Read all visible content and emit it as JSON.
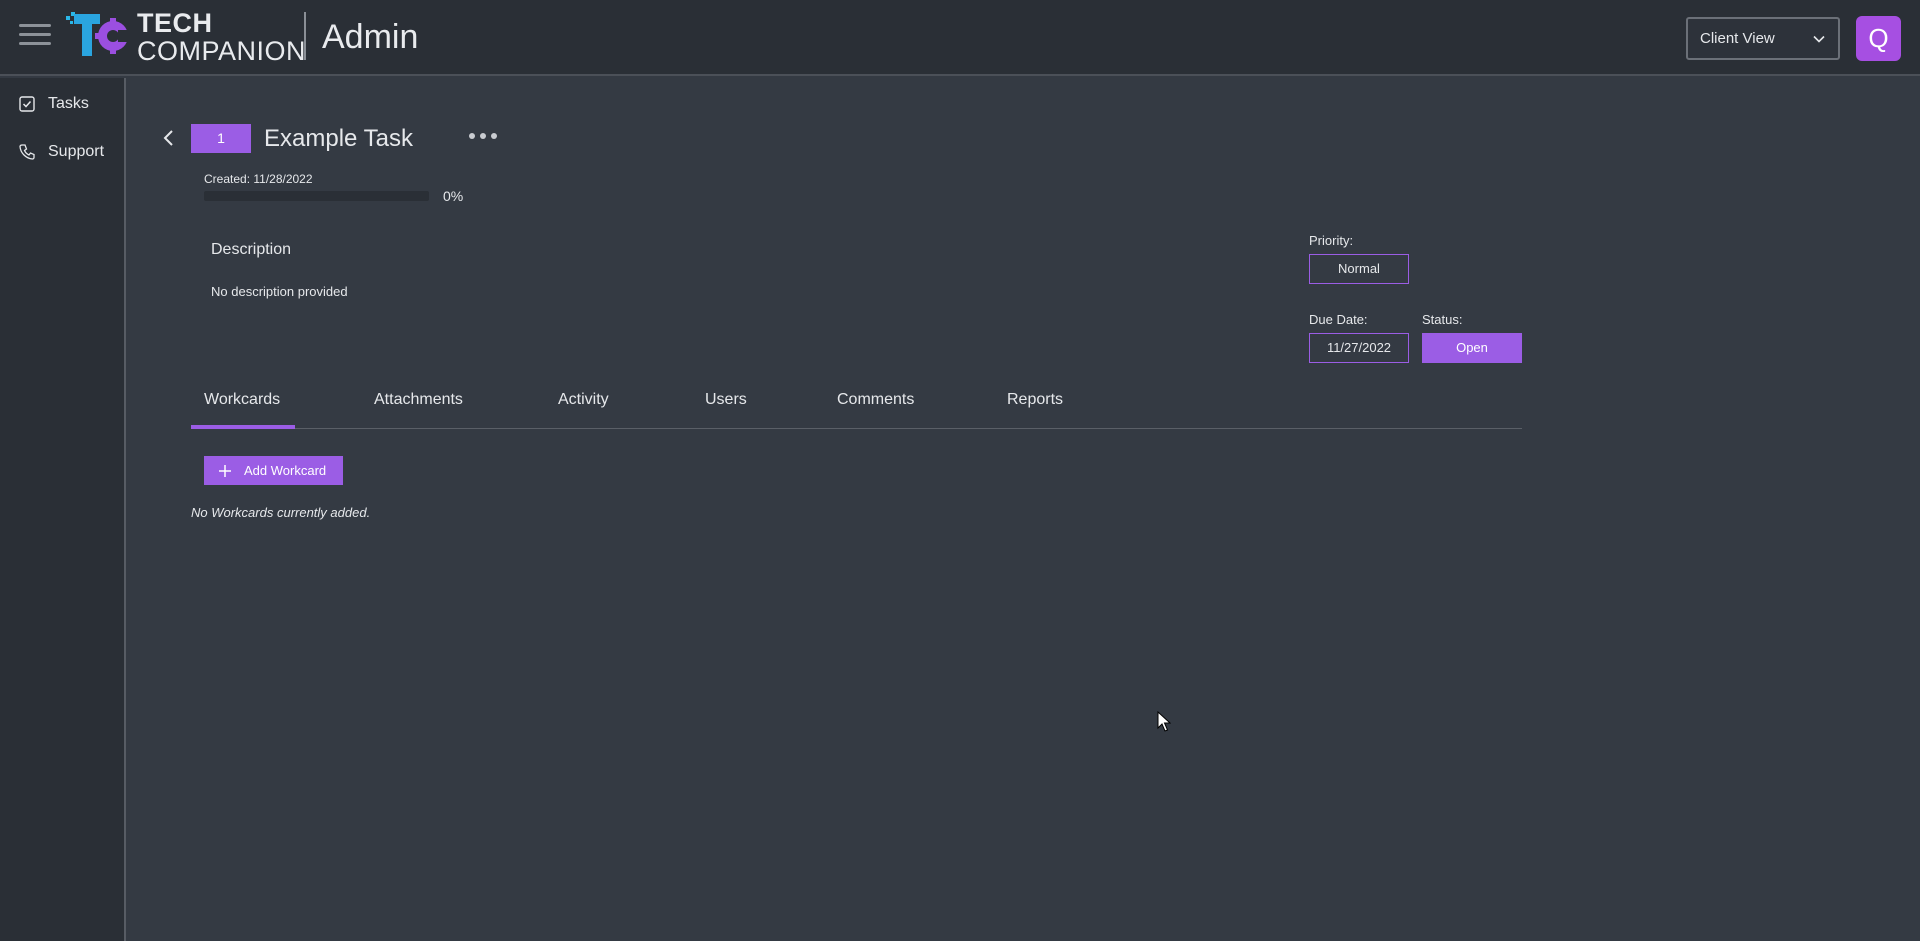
{
  "header": {
    "brand_line1": "TECH",
    "brand_line2": "COMPANION",
    "app_title": "Admin",
    "view_select": {
      "value": "Client View"
    },
    "avatar_letter": "Q",
    "icons": {
      "menu": "hamburger-menu-icon",
      "logo": "tc-logo-icon",
      "dropdown": "chevron-down-icon"
    }
  },
  "sidebar": {
    "items": [
      {
        "label": "Tasks",
        "icon": "checkbox-icon"
      },
      {
        "label": "Support",
        "icon": "phone-icon"
      }
    ]
  },
  "task": {
    "number": "1",
    "title": "Example Task",
    "created": "Created: 11/28/2022",
    "progress": 0,
    "progress_label": "0%",
    "description_heading": "Description",
    "description_text": "No description provided",
    "priority_label": "Priority:",
    "priority_value": "Normal",
    "due_label": "Due Date:",
    "due_value": "11/27/2022",
    "status_label": "Status:",
    "status_value": "Open"
  },
  "tabs": [
    {
      "label": "Workcards",
      "active": true
    },
    {
      "label": "Attachments"
    },
    {
      "label": "Activity"
    },
    {
      "label": "Users"
    },
    {
      "label": "Comments"
    },
    {
      "label": "Reports"
    }
  ],
  "workcards": {
    "add_label": "Add Workcard",
    "empty_text": "No Workcards currently added."
  },
  "colors": {
    "accent": "#9b5de5",
    "avatar": "#a64fe2",
    "background": "#343a43",
    "panel": "#2a2f36"
  }
}
